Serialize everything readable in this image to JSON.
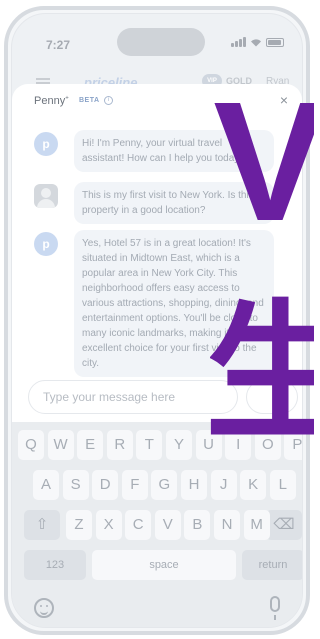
{
  "status": {
    "time": "7:27"
  },
  "header": {
    "brand": "priceline",
    "vip": "VIP",
    "tier": "GOLD",
    "user": "Ryan"
  },
  "chat": {
    "title": "Penny",
    "title_mark": "+",
    "badge": "BETA",
    "info": "i",
    "close": "×",
    "messages": [
      {
        "from": "assistant",
        "avatar": "p",
        "text": "Hi! I'm Penny, your virtual travel assistant! How can I help you today?"
      },
      {
        "from": "user",
        "text": "This is my first visit to New York. Is this property in a good location?"
      },
      {
        "from": "assistant",
        "avatar": "p",
        "text": "Yes, Hotel 57 is in a great location! It's situated in Midtown East, which is a popular area in New York City. This neighborhood offers easy access to various attractions, shopping, dining, and entertainment options. You'll be close to many iconic landmarks, making it an excellent choice for your first visit to the city."
      }
    ]
  },
  "composer": {
    "placeholder": "Type your message here"
  },
  "keyboard": {
    "row1": [
      "Q",
      "W",
      "E",
      "R",
      "T",
      "Y",
      "U",
      "I",
      "O",
      "P"
    ],
    "row2": [
      "A",
      "S",
      "D",
      "F",
      "G",
      "H",
      "J",
      "K",
      "L"
    ],
    "row3": [
      "Z",
      "X",
      "C",
      "V",
      "B",
      "N",
      "M"
    ],
    "shift": "⇧",
    "backspace": "⌫",
    "numbers": "123",
    "space": "space",
    "return": "return"
  },
  "watermark": {
    "line1": "V",
    "line2": "生",
    "color": "#6a1fa0"
  }
}
